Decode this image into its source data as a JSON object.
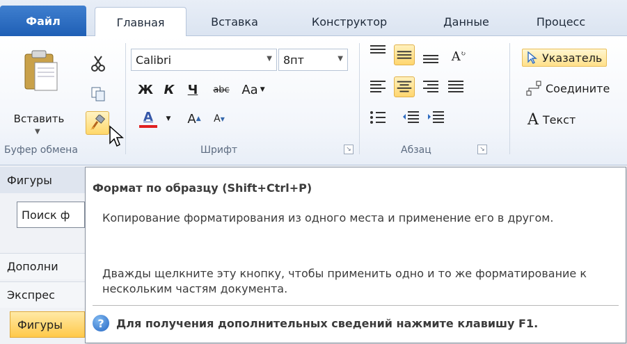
{
  "tabs": [
    {
      "label": "Файл"
    },
    {
      "label": "Главная"
    },
    {
      "label": "Вставка"
    },
    {
      "label": "Конструктор"
    },
    {
      "label": "Данные"
    },
    {
      "label": "Процесс"
    }
  ],
  "clipboard": {
    "paste_label": "Вставить",
    "group_label": "Буфер обмена"
  },
  "font": {
    "family": "Calibri",
    "size": "8пт",
    "bold": "Ж",
    "italic": "К",
    "underline": "Ч",
    "strike": "abc",
    "change_case": "Aa",
    "color_letter": "A",
    "grow": "A",
    "shrink": "A",
    "group_label": "Шрифт"
  },
  "paragraph": {
    "group_label": "Абзац"
  },
  "tools": {
    "pointer": "Указатель",
    "connector": "Соедините",
    "text": "Текст",
    "text_icon": "A"
  },
  "sidebar": {
    "header": "Фигуры",
    "search": "Поиск ф",
    "more": "Дополни",
    "express": "Экспрес",
    "shapes": "Фигуры"
  },
  "tooltip": {
    "title": "Формат по образцу (Shift+Ctrl+P)",
    "paragraph1": "Копирование форматирования из одного места и применение его в другом.",
    "paragraph2": "Дважды щелкните эту кнопку, чтобы применить одно и то же форматирование к нескольким частям документа.",
    "help_text": "Для получения дополнительных сведений нажмите клавишу F1.",
    "help_icon_glyph": "?"
  },
  "colors": {
    "file_tab": "#2b6cc2",
    "highlight": "#ffd86a",
    "font_color_bar": "#e02020"
  }
}
